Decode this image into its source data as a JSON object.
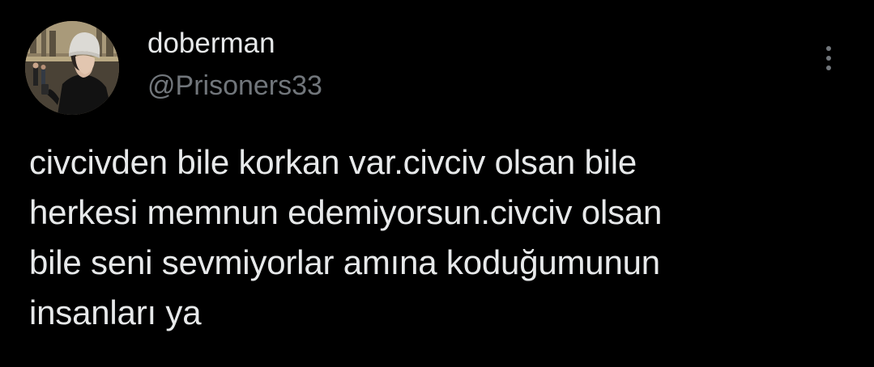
{
  "author": {
    "display_name": "doberman",
    "handle": "@Prisoners33",
    "avatar_icon": "profile-photo"
  },
  "more_icon": "more-options-icon",
  "tweet": {
    "text": "civcivden bile korkan var.civciv olsan bile\nherkesi memnun edemiyorsun.civciv olsan\nbile seni sevmiyorlar amına koduğumunun\ninsanları ya"
  },
  "colors": {
    "background": "#000000",
    "primary_text": "#e7e9ea",
    "secondary_text": "#71767b"
  }
}
